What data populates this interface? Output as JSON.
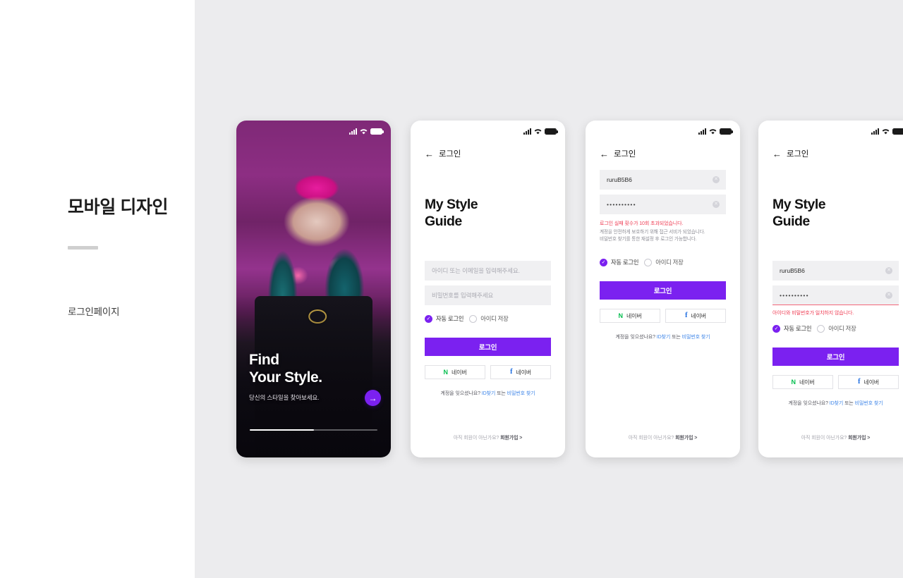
{
  "sidebar": {
    "title": "모바일 디자인",
    "items": [
      {
        "label": "로그인페이지"
      }
    ]
  },
  "colors": {
    "canvas": "#ececee",
    "primary": "#7b21f0",
    "error": "#ef3b52",
    "link": "#3f86e8",
    "naver_green": "#05be4f",
    "facebook_blue": "#1a6ae0",
    "field_bg": "#f0f0f2"
  },
  "statusbar": {
    "signal_icon": "signal-bars-icon",
    "wifi_icon": "wifi-icon",
    "battery_icon": "battery-icon"
  },
  "screens": {
    "onboarding": {
      "title_line1": "Find",
      "title_line2": "Your Style.",
      "subtitle": "당신의 스타일을 찾아보세요.",
      "next_icon": "arrow-right-icon",
      "progress_percent": 50
    },
    "login_default": {
      "nav": {
        "back_icon": "arrow-left-icon",
        "label": "로그인"
      },
      "headline_line1": "My Style",
      "headline_line2": "Guide",
      "id_placeholder": "아이디 또는 이메일을 입력해주세요.",
      "pw_placeholder": "비밀번호를 입력해주세요",
      "checkbox_auto_login": "자동 로그인",
      "checkbox_save_id": "아이디 저장",
      "login_button": "로그인",
      "social_naver": "네이버",
      "social_facebook": "네이버",
      "find_prefix": "계정을 잊으셨나요?",
      "find_id": "ID찾기",
      "find_or": "또는",
      "find_pw": "비밀번호 찾기",
      "signup_prefix": "아직 회원이 아닌가요?",
      "signup_link": "회원가입 >"
    },
    "login_locked": {
      "nav": {
        "back_icon": "arrow-left-icon",
        "label": "로그인"
      },
      "id_value": "ruruB5B6",
      "pw_value": "••••••••••",
      "clear_icon": "clear-circle-icon",
      "error_main": "로그인 실패 횟수가 10회 초과되었습니다.",
      "error_sub_line1": "계정을 안전하게 보호하기 위해 접근 서비가 되었습니다.",
      "error_sub_line2": "비밀번호 찾기를 통한 재설정 후 로그인 가능합니다.",
      "checkbox_auto_login": "자동 로그인",
      "checkbox_save_id": "아이디 저장",
      "login_button": "로그인",
      "social_naver": "네이버",
      "social_facebook": "네이버",
      "find_prefix": "계정을 잊으셨나요?",
      "find_id": "ID찾기",
      "find_or": "또는",
      "find_pw": "비밀번호 찾기",
      "signup_prefix": "아직 회원이 아닌가요?",
      "signup_link": "회원가입 >"
    },
    "login_mismatch": {
      "nav": {
        "back_icon": "arrow-left-icon",
        "label": "로그인"
      },
      "headline_line1": "My Style",
      "headline_line2": "Guide",
      "id_value": "ruruB5B6",
      "pw_value": "••••••••••",
      "clear_icon": "clear-circle-icon",
      "error_main": "아이디와 비밀번호가 일치하지 않습니다.",
      "checkbox_auto_login": "자동 로그인",
      "checkbox_save_id": "아이디 저장",
      "login_button": "로그인",
      "social_naver": "네이버",
      "social_facebook": "네이버",
      "find_prefix": "계정을 잊으셨나요?",
      "find_id": "ID찾기",
      "find_or": "또는",
      "find_pw": "비밀번호 찾기",
      "signup_prefix": "아직 회원이 아닌가요?",
      "signup_link": "회원가입 >"
    }
  }
}
